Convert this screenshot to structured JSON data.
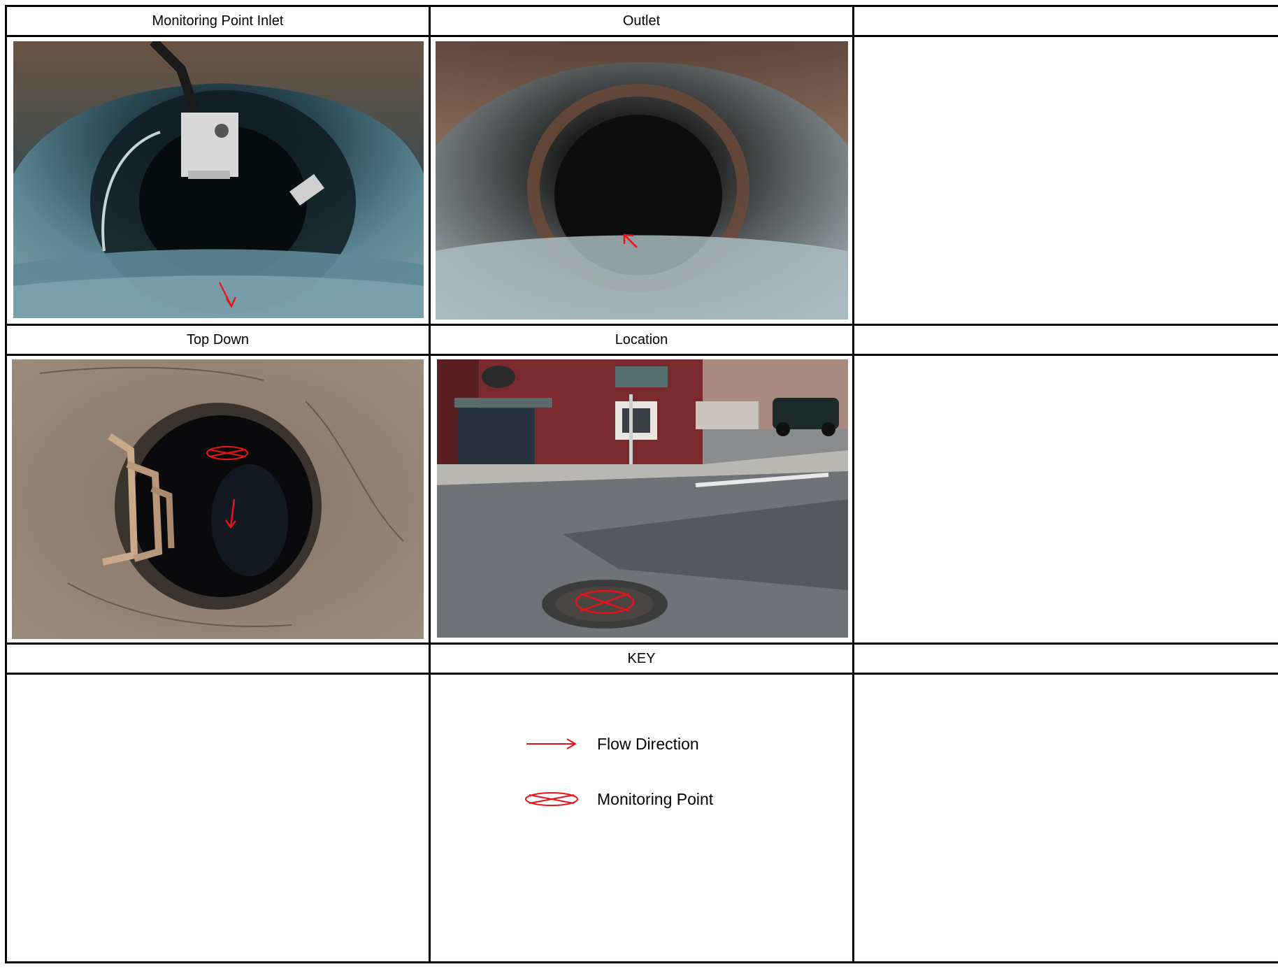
{
  "headers": {
    "row1": [
      "Monitoring Point Inlet",
      "Outlet",
      ""
    ],
    "row2": [
      "Top Down",
      "Location",
      ""
    ],
    "row3": [
      "",
      "KEY",
      ""
    ]
  },
  "photos": {
    "inlet": "pipe-inlet-photo",
    "outlet": "pipe-outlet-photo",
    "top_down": "manhole-top-down-photo",
    "location": "street-location-photo"
  },
  "key": {
    "items": [
      {
        "icon": "red-arrow-icon",
        "label": "Flow Direction"
      },
      {
        "icon": "crossed-ellipse-icon",
        "label": "Monitoring Point"
      }
    ]
  },
  "colors": {
    "annotation": "#e8141c",
    "border": "#000000"
  }
}
